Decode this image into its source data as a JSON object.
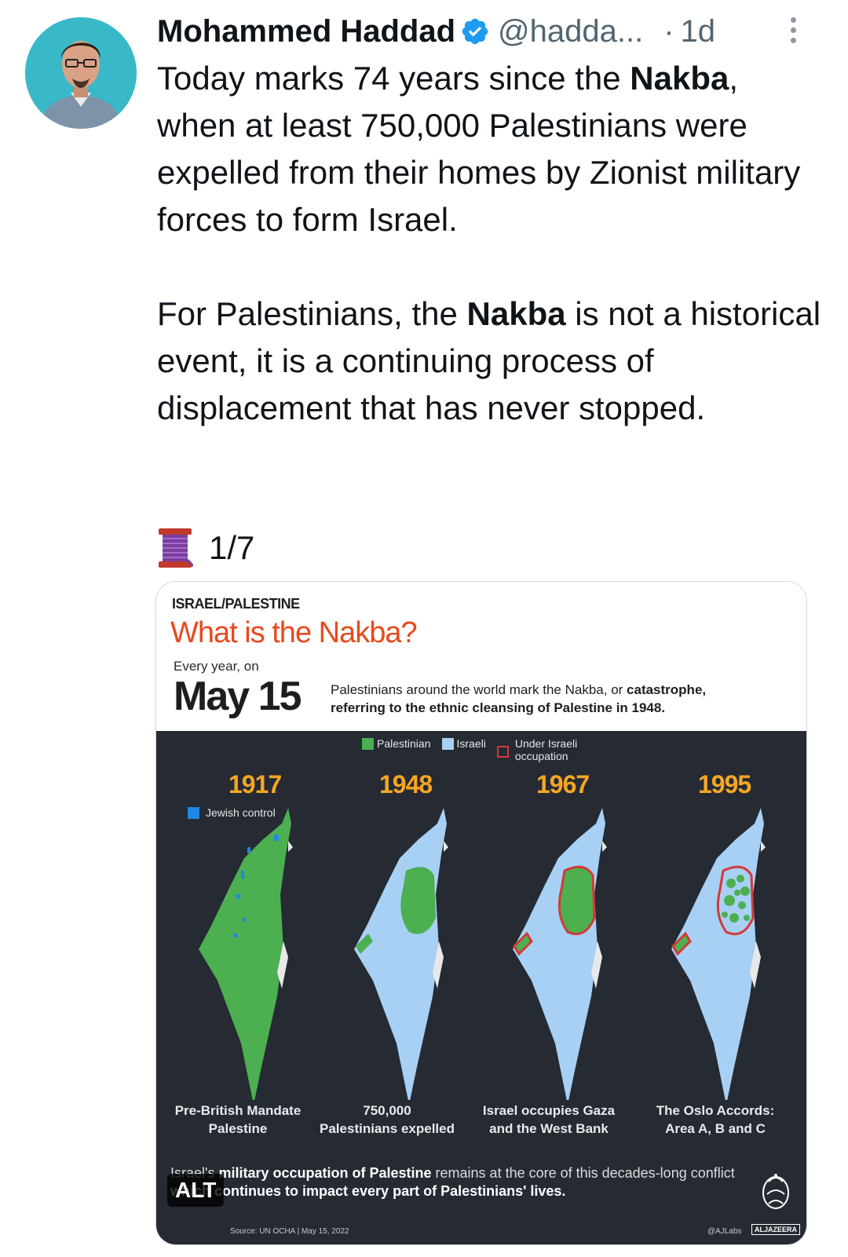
{
  "tweet": {
    "author_name": "Mohammed Haddad",
    "handle": "@hadda...",
    "separator": "·",
    "time": "1d",
    "paragraph1": {
      "a": "Today marks 74 years since the ",
      "b": "Nakba",
      "c": ", when at least 750,000 Palestinians were expelled from their homes by Zionist military forces to form Israel."
    },
    "paragraph2": {
      "a": "For Palestinians, the ",
      "b": "Nakba",
      "c": " is not a historical event, it is a continuing process of displacement that has never stopped."
    },
    "thread_icon": "spool-of-thread-icon",
    "thread_label": "1/7"
  },
  "media": {
    "alt_badge": "ALT",
    "kicker": "ISRAEL/PALESTINE",
    "title": "What is the Nakba?",
    "every_year": "Every year, on",
    "date": "May 15",
    "subtitle": {
      "a": "Palestinians around the world mark the Nakba, or ",
      "b": "catastrophe,",
      "c": "referring to the ethnic cleansing of Palestine in 1948."
    },
    "legend": {
      "palestinian": "Palestinian",
      "israeli": "Israeli",
      "occupation_1": "Under Israeli",
      "occupation_2": "occupation",
      "jewish_control": "Jewish control"
    },
    "years": [
      "1917",
      "1948",
      "1967",
      "1995"
    ],
    "captions": [
      {
        "l1": "Pre-British Mandate",
        "l2": "Palestine"
      },
      {
        "l1": "750,000",
        "l2": "Palestinians expelled"
      },
      {
        "l1": "Israel occupies Gaza",
        "l2": "and the West Bank"
      },
      {
        "l1": "The Oslo Accords:",
        "l2": "Area A, B and C"
      }
    ],
    "footer": {
      "a": "Israel's ",
      "b": "military occupation of Palestine",
      "c": " remains at the core of this decades-long conflict ",
      "d": "which continues to impact every part of Palestinians' lives."
    },
    "source": "Source: UN OCHA | May 15, 2022",
    "credit": "@AJLabs",
    "brand": "ALJAZEERA",
    "colors": {
      "palestinian": "#4caf50",
      "israeli": "#a8d0f5",
      "occupation": "#d43a3a",
      "jewish": "#1e88e5",
      "year": "#f5a623",
      "title": "#e8491d",
      "verified": "#1d9bf0"
    }
  }
}
